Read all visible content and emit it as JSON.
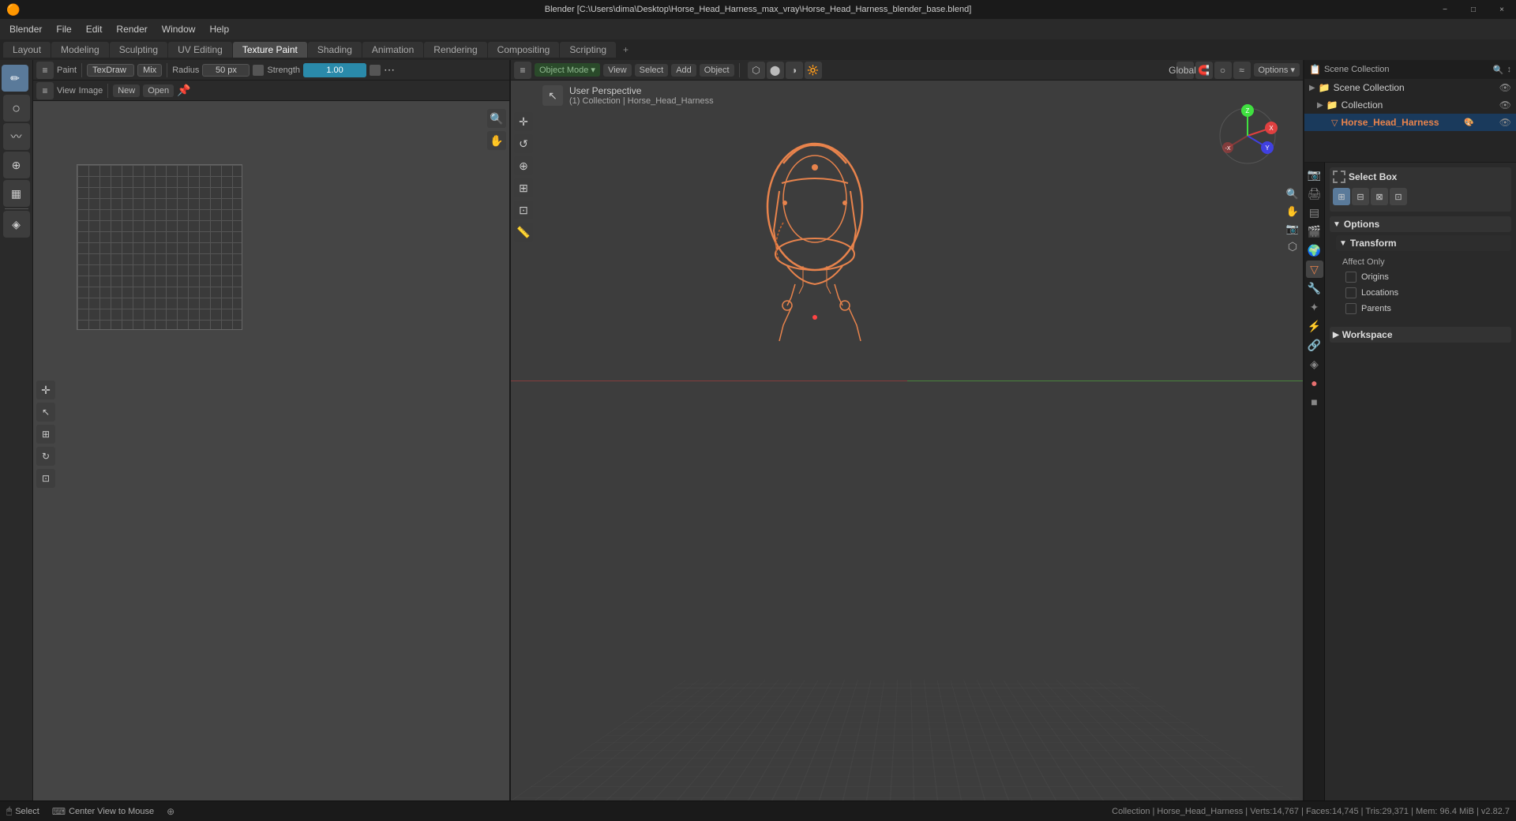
{
  "window": {
    "title": "Blender [C:\\Users\\dima\\Desktop\\Horse_Head_Harness_max_vray\\Horse_Head_Harness_blender_base.blend]",
    "controls": [
      "−",
      "□",
      "×"
    ]
  },
  "menubar": {
    "items": [
      "Blender",
      "File",
      "Edit",
      "Render",
      "Window",
      "Help"
    ]
  },
  "workspace_tabs": {
    "tabs": [
      "Layout",
      "Modeling",
      "Sculpting",
      "UV Editing",
      "Texture Paint",
      "Shading",
      "Animation",
      "Rendering",
      "Compositing",
      "Scripting"
    ],
    "active": "Texture Paint",
    "plus": "+"
  },
  "paint_toolbar": {
    "mode_label": "Paint",
    "brush_label": "TexDraw",
    "blend_label": "Mix",
    "radius_label": "Radius",
    "radius_value": "50 px",
    "strength_label": "Strength",
    "strength_value": "1.00",
    "view_label": "View",
    "image_label": "Image",
    "new_label": "New",
    "open_label": "Open"
  },
  "left_tools": {
    "tools": [
      {
        "name": "draw",
        "icon": "✏",
        "tooltip": "Draw"
      },
      {
        "name": "soften",
        "icon": "○",
        "tooltip": "Soften"
      },
      {
        "name": "smear",
        "icon": "≈",
        "tooltip": "Smear"
      },
      {
        "name": "clone",
        "icon": "⊕",
        "tooltip": "Clone"
      },
      {
        "name": "fill",
        "icon": "▦",
        "tooltip": "Fill"
      },
      {
        "name": "mask",
        "icon": "◈",
        "tooltip": "Mask"
      }
    ],
    "active": "draw"
  },
  "viewport3d": {
    "mode": "Object Mode",
    "perspective": "User Perspective",
    "collection_info": "(1) Collection | Horse_Head_Harness",
    "menus": [
      "Object Mode",
      "View",
      "Select",
      "Add",
      "Object"
    ],
    "global_label": "Global",
    "options_label": "Options"
  },
  "outliner": {
    "header": "Scene Collection",
    "items": [
      {
        "name": "Collection",
        "icon": "📁",
        "indent": 0,
        "visible": true
      },
      {
        "name": "Horse_Head_Harness",
        "icon": "▽",
        "indent": 1,
        "visible": true,
        "selected": true,
        "color": "orange"
      }
    ]
  },
  "properties_panel": {
    "icons": [
      {
        "name": "render",
        "icon": "📷",
        "active": false
      },
      {
        "name": "output",
        "icon": "🖨",
        "active": false
      },
      {
        "name": "view-layer",
        "icon": "▤",
        "active": false
      },
      {
        "name": "scene",
        "icon": "🎬",
        "active": false
      },
      {
        "name": "world",
        "icon": "🌍",
        "active": false
      },
      {
        "name": "object",
        "icon": "▽",
        "active": true
      },
      {
        "name": "modifier",
        "icon": "🔧",
        "active": false
      },
      {
        "name": "particles",
        "icon": "✦",
        "active": false
      },
      {
        "name": "physics",
        "icon": "⚡",
        "active": false
      },
      {
        "name": "constraints",
        "icon": "🔗",
        "active": false
      },
      {
        "name": "data",
        "icon": "◈",
        "active": false
      },
      {
        "name": "material",
        "icon": "●",
        "active": false
      },
      {
        "name": "texture",
        "icon": "■",
        "active": false
      }
    ],
    "select_box": {
      "label": "Select Box",
      "modes": [
        "⊞",
        "⊟",
        "⊠",
        "⊡"
      ]
    },
    "options": {
      "label": "Options",
      "transform": {
        "label": "Transform",
        "affect_only": {
          "label": "Affect Only",
          "origins": "Origins",
          "locations": "Locations",
          "parents": "Parents"
        }
      }
    },
    "workspace": {
      "label": "Workspace"
    }
  },
  "statusbar": {
    "select_label": "Select",
    "center_view_label": "Center View to Mouse",
    "scene_info": "Collection | Horse_Head_Harness | Verts:14,767 | Faces:14,745 | Tris:29,371 | Mem: 96.4 MiB | v2.82.7"
  },
  "colors": {
    "accent_orange": "#e8834c",
    "accent_blue": "#2a8aaa",
    "bg_dark": "#1a1a1a",
    "bg_medium": "#2a2a2a",
    "bg_light": "#3d3d3d",
    "selected_blue": "#1a3a5c"
  }
}
